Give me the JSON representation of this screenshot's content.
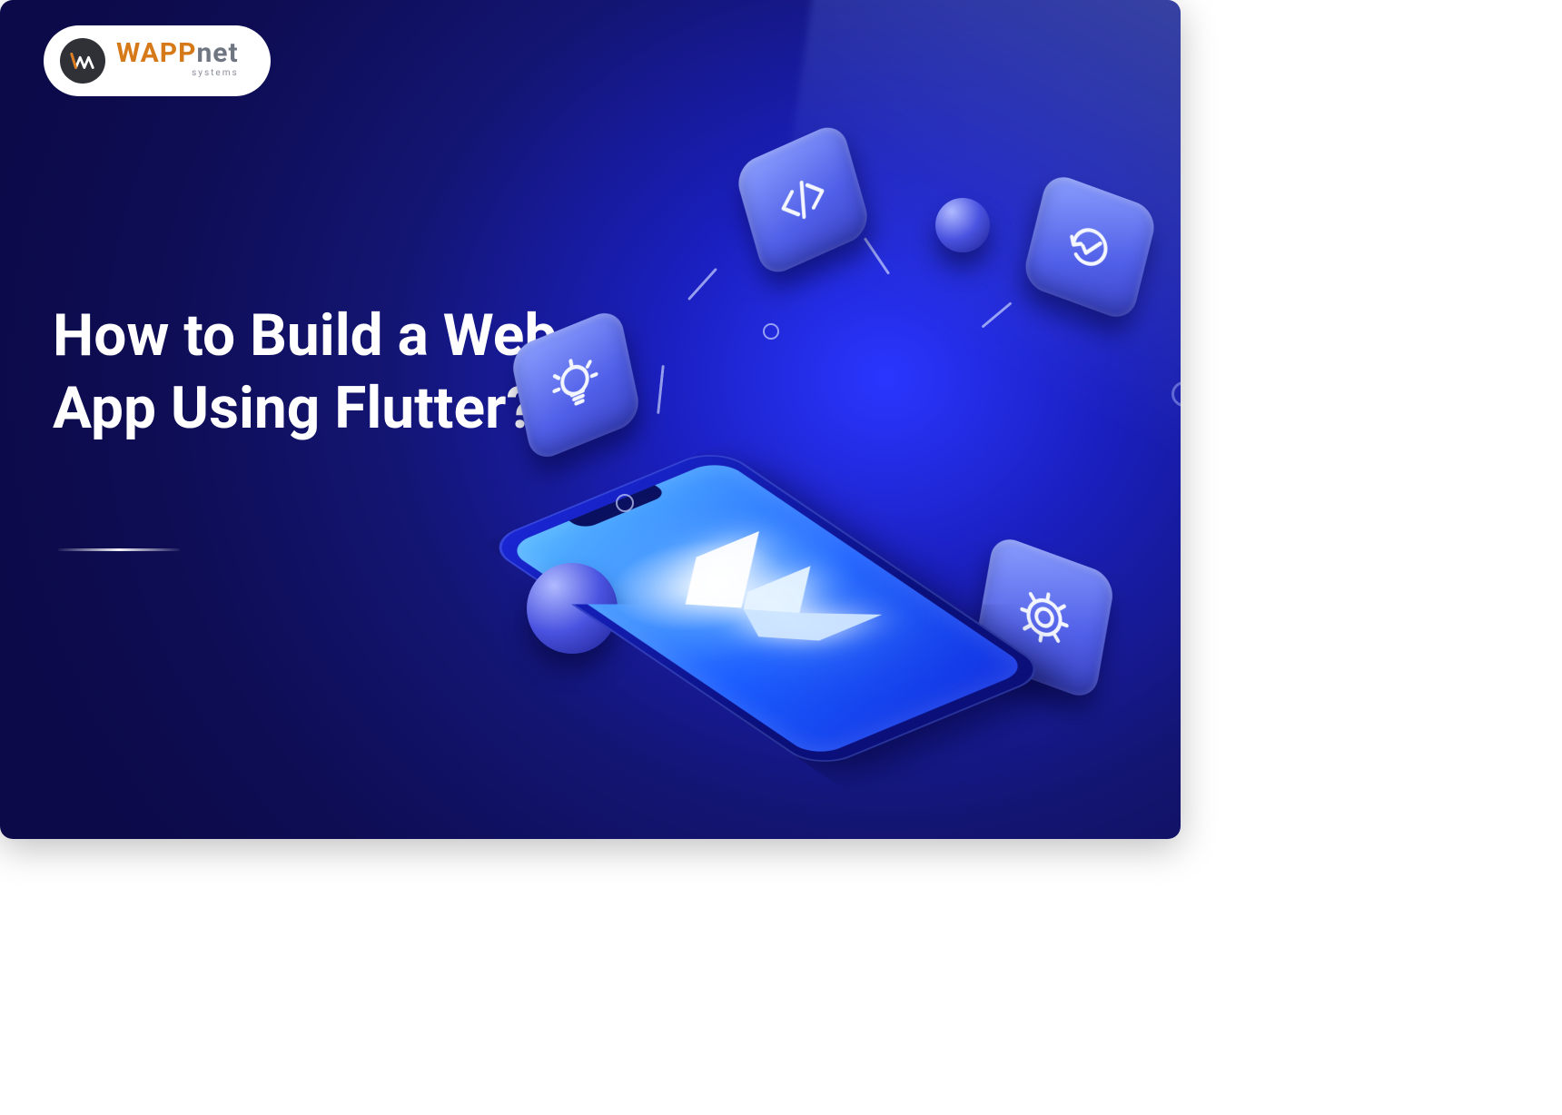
{
  "logo": {
    "word_left": "WAPP",
    "word_right": "net",
    "subtitle": "systems"
  },
  "headline": "How to Build a Web App Using Flutter?",
  "icons": {
    "code": "code-icon",
    "sync": "sync-icon",
    "gear": "gear-icon",
    "bulb": "lightbulb-icon",
    "flutter": "flutter-logo"
  }
}
